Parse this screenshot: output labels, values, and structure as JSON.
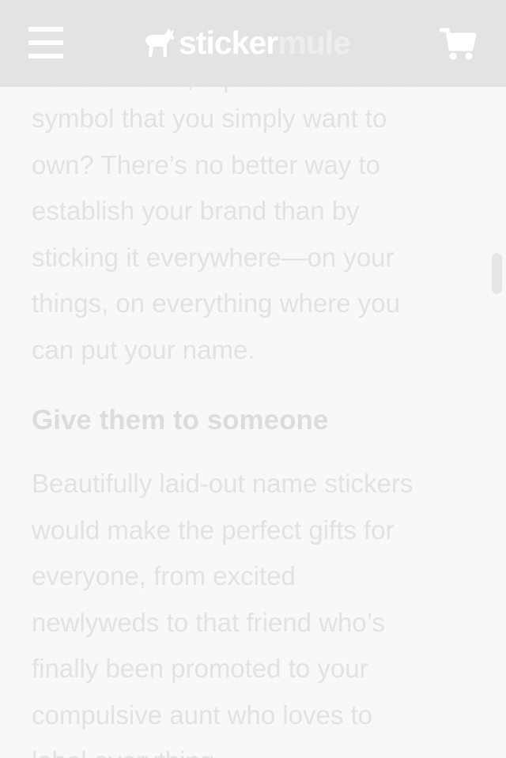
{
  "header": {
    "menu_icon": "hamburger-menu-icon",
    "logo": {
      "icon": "mule-logo-icon",
      "part1": "sticker",
      "part2": "mule"
    },
    "cart_icon": "shopping-cart-icon"
  },
  "article": {
    "partial_top_line": "Have a name, a personal brand or",
    "paragraph1": [
      "symbol that you simply want to",
      "own? There’s no better way to",
      "establish your brand than by",
      "sticking it everywhere—on your",
      "things, on everything where you",
      "can put your name."
    ],
    "heading": "Give them to someone",
    "paragraph2": [
      "Beautifully laid-out name stickers",
      "would make the perfect gifts for",
      "everyone, from excited",
      "newlyweds to that friend who’s",
      "finally been promoted to your",
      "compulsive aunt who loves to",
      "label everything."
    ]
  },
  "colors": {
    "header_bg": "#e3e3e3",
    "page_bg": "#f8f8f8",
    "text": "#e2e2e2"
  }
}
